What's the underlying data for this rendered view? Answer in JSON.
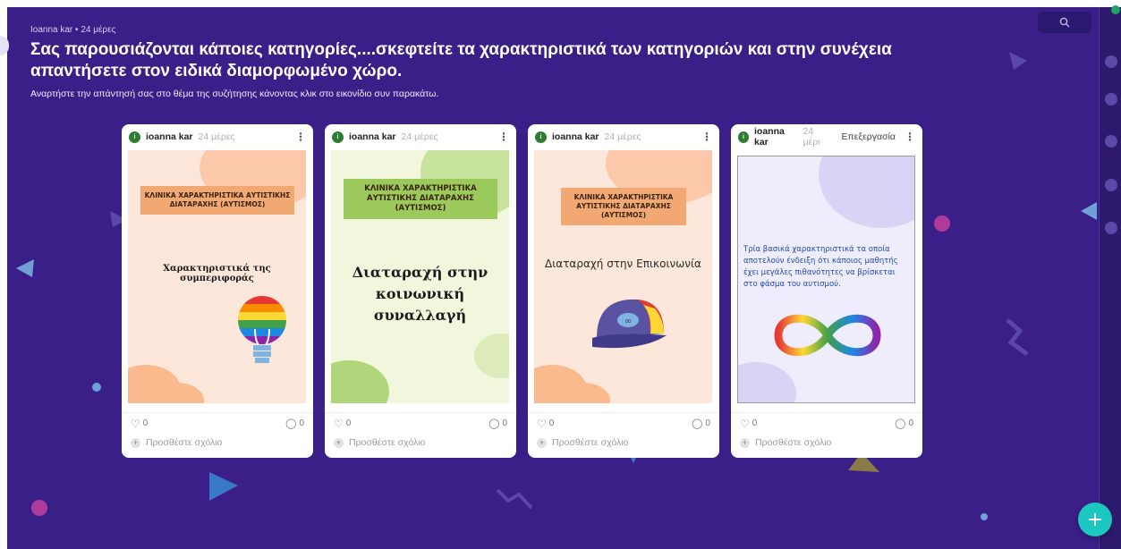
{
  "post": {
    "meta": "Ioanna kar • 24 μέρες",
    "title_line1": "Σας παρουσιάζονται κάποιες κατηγορίες....σκεφτείτε τα χαρακτηριστικά των κατηγοριών  και στην συνέχεια",
    "title_line2": "απαντήσετε στον ειδικά διαμορφωμένο χώρο.",
    "subtitle": "Αναρτήστε την απάντησή σας στο θέμα της συζήτησης κάνοντας κλικ στο εικονίδιο συν παρακάτω."
  },
  "cards": [
    {
      "avatar_letter": "i",
      "author": "ioanna kar",
      "age": "24 μέρες",
      "banner": "ΚΛΙΝΙΚΑ ΧΑΡΑΚΤΗΡΙΣΤΙΚΑ ΑΥΤΙΣΤΙΚΗΣ ΔΙΑΤΑΡΑΧΗΣ (ΑΥΤΙΣΜΟΣ)",
      "heading": "Χαρακτηριστικά της συμπεριφοράς",
      "likes": "0",
      "comments": "0",
      "add_comment": "Προσθέστε σχόλιο"
    },
    {
      "avatar_letter": "i",
      "author": "ioanna kar",
      "age": "24 μέρες",
      "banner": "ΚΛΙΝΙΚΑ ΧΑΡΑΚΤΗΡΙΣΤΙΚΑ ΑΥΤΙΣΤΙΚΗΣ ΔΙΑΤΑΡΑΧΗΣ (ΑΥΤΙΣΜΟΣ)",
      "heading_line1": "Διαταραχή στην",
      "heading_line2": "κοινωνική",
      "heading_line3": "συναλλαγή",
      "likes": "0",
      "comments": "0",
      "add_comment": "Προσθέστε σχόλιο"
    },
    {
      "avatar_letter": "i",
      "author": "ioanna kar",
      "age": "24 μέρες",
      "banner": "ΚΛΙΝΙΚΑ ΧΑΡΑΚΤΗΡΙΣΤΙΚΑ ΑΥΤΙΣΤΙΚΗΣ ΔΙΑΤΑΡΑΧΗΣ (ΑΥΤΙΣΜΟΣ)",
      "heading": "Διαταραχή στην Επικοινωνία",
      "likes": "0",
      "comments": "0",
      "add_comment": "Προσθέστε σχόλιο"
    },
    {
      "avatar_letter": "i",
      "author": "ioanna kar",
      "age": "24 μέρι",
      "edit_label": "Επεξεργασία",
      "text": "Τρία βασικά χαρακτηριστικά τα οποία αποτελούν ένδειξη ότι κάποιος μαθητής έχει μεγάλες πιθανότητες να βρίσκεται στο φάσμα του αυτισμού.",
      "likes": "0",
      "comments": "0",
      "add_comment": "Προσθέστε σχόλιο"
    }
  ],
  "icons": {
    "search": "search-icon",
    "heart": "heart-icon",
    "comment": "comment-icon",
    "plus": "plus-icon",
    "more": "more-vertical-icon"
  },
  "colors": {
    "background": "#3a1f88",
    "fab": "#1cc7c1",
    "avatar": "#2e7d32"
  }
}
